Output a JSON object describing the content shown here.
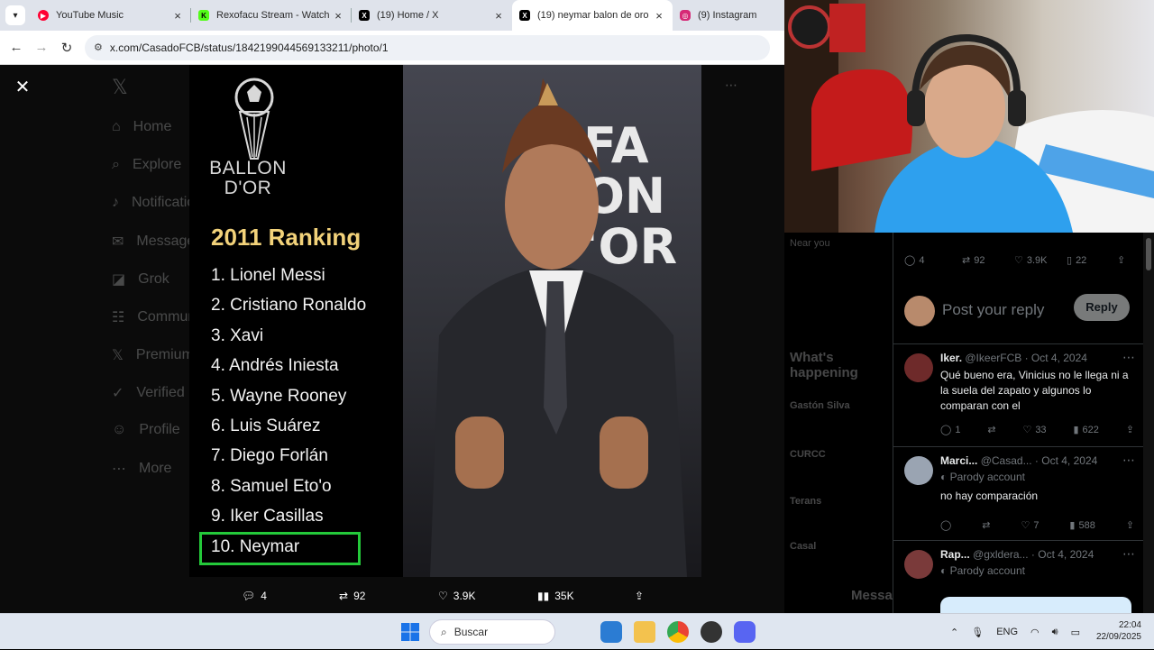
{
  "tabs": [
    {
      "title": "YouTube Music",
      "color": "#ff0033"
    },
    {
      "title": "Rexofacu Stream - Watch Liv",
      "color": "#53fc18"
    },
    {
      "title": "(19) Home / X",
      "color": "#000000"
    },
    {
      "title": "(19) neymar balon de oro",
      "color": "#000000",
      "active": true
    },
    {
      "title": "(9) Instagram",
      "color": "#d62976"
    }
  ],
  "address": {
    "url": "x.com/CasadoFCB/status/1842199044569133211/photo/1"
  },
  "ranking": {
    "brand_line1": "BALLON",
    "brand_line2": "D'OR",
    "title": "2011 Ranking",
    "items": [
      "1. Lionel Messi",
      "2. Cristiano Ronaldo",
      "3. Xavi",
      "4. Andrés Iniesta",
      "5. Wayne Rooney",
      "6. Luis Suárez",
      "7. Diego Forlán",
      "8. Samuel Eto'o",
      "9. Iker Casillas",
      "10. Neymar"
    ],
    "highlight_color": "#24c93a"
  },
  "photo": {
    "backdrop_line1": "FA",
    "backdrop_line2": "ON",
    "backdrop_line3": "'OR"
  },
  "bg_nav": [
    "Home",
    "Explore",
    "Notifications",
    "Messages",
    "Grok",
    "Communities",
    "Premium",
    "Verified",
    "Profile",
    "More"
  ],
  "media_actions": {
    "replies": "4",
    "reposts": "92",
    "likes": "3.9K",
    "views": "35K"
  },
  "post_stats": {
    "replies": "4",
    "reposts": "92",
    "likes": "3.9K",
    "bookmarks": "22"
  },
  "reply": {
    "placeholder": "Post your reply",
    "button": "Reply"
  },
  "bg_right": {
    "heading": "What's happening",
    "t1": "Gastón Silva",
    "t2": "CURCC",
    "t3": "Terans",
    "t4": "Casal",
    "messages": "Messages",
    "near": "Near you"
  },
  "comments": [
    {
      "name": "Iker.",
      "handle": "@IkeerFCB",
      "date": "· Oct 4, 2024",
      "parody": "",
      "text": "Qué bueno era, Vinicius no le llega ni a la suela del zapato y algunos lo comparan con el",
      "replies": "1",
      "reposts": "",
      "likes": "33",
      "views": "622"
    },
    {
      "name": "Marci...",
      "handle": "@Casad...",
      "date": "· Oct 4, 2024",
      "parody": "Parody account",
      "text": "no hay comparación",
      "replies": "",
      "reposts": "",
      "likes": "7",
      "views": "588"
    },
    {
      "name": "Rap...",
      "handle": "@gxldera...",
      "date": "· Oct 4, 2024",
      "parody": "Parody account",
      "text": "",
      "replies": "",
      "reposts": "",
      "likes": "",
      "views": ""
    }
  ],
  "taskbar": {
    "search": "Buscar",
    "lang": "ENG",
    "time": "22:04",
    "date": "22/09/2025"
  }
}
